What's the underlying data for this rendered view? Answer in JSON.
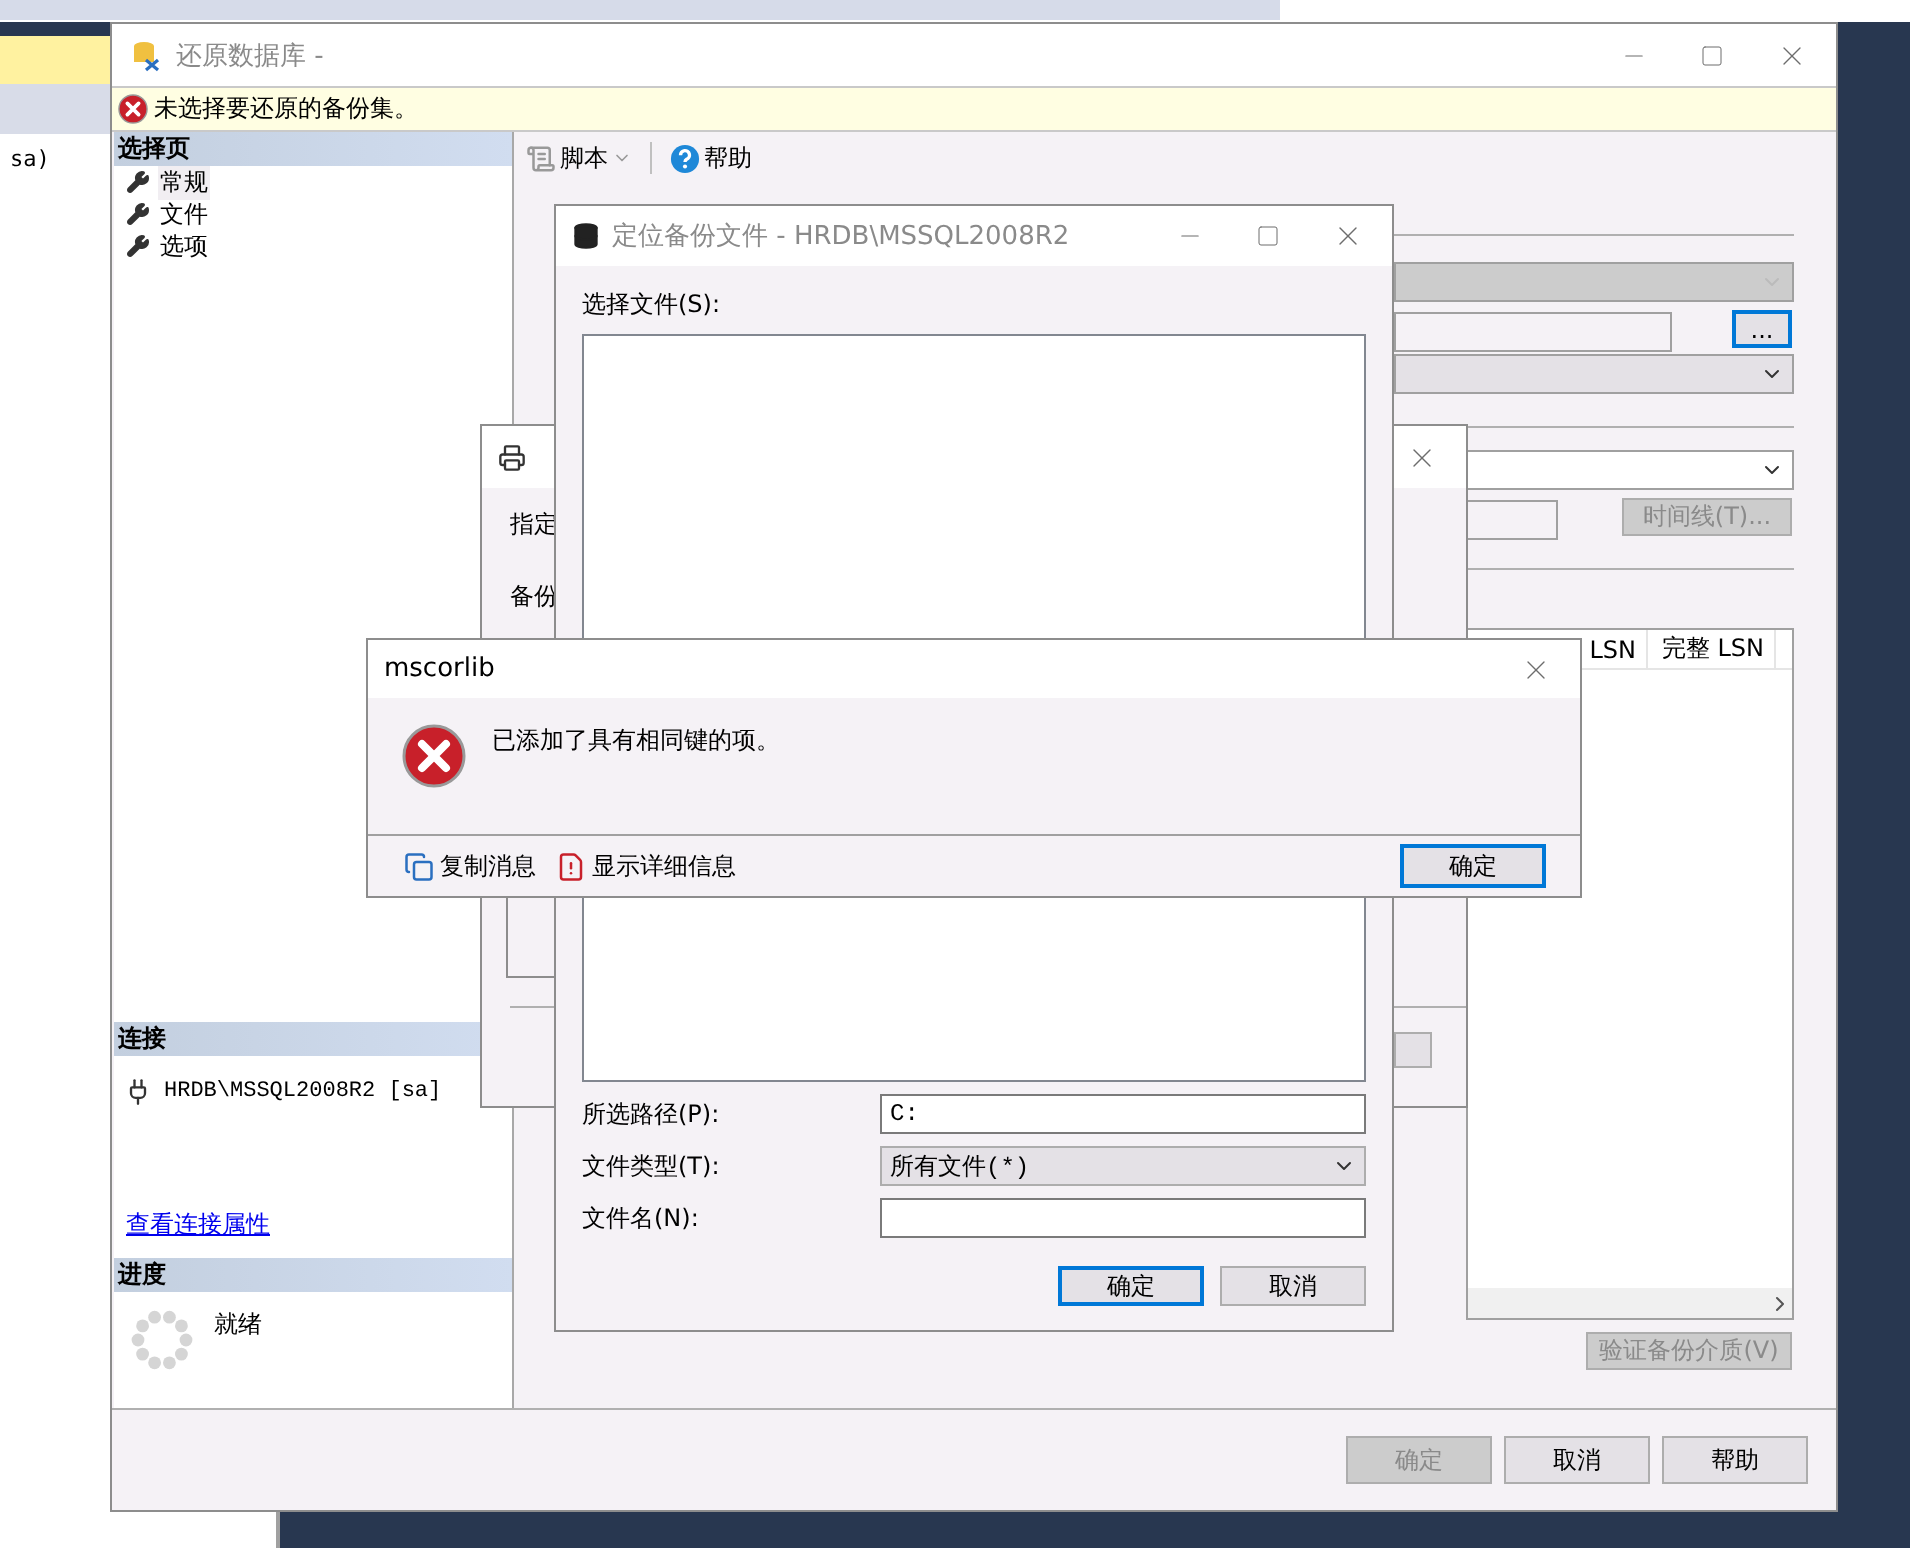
{
  "background_window": {
    "text": "sa)"
  },
  "restore_window": {
    "title": "还原数据库 -",
    "error_bar": "未选择要还原的备份集。",
    "select_page": {
      "header": "选择页",
      "items": [
        {
          "label": "常规",
          "selected": true
        },
        {
          "label": "文件",
          "selected": false
        },
        {
          "label": "选项",
          "selected": false
        }
      ]
    },
    "connection": {
      "header": "连接",
      "server": "HRDB\\MSSQL2008R2 [sa]",
      "link": "查看连接属性"
    },
    "progress": {
      "header": "进度",
      "status": "就绪"
    },
    "toolbar": {
      "script": "脚本",
      "help": "帮助"
    },
    "browse_button": {
      "label": "...",
      "focused": true
    },
    "timeline_button": {
      "label": "时间线(T)...",
      "disabled": true
    },
    "grid_columns": [
      "LSN",
      "完整 LSN"
    ],
    "verify_button": {
      "label": "验证备份介质(V)",
      "disabled": true
    },
    "buttons": [
      {
        "label": "确定",
        "disabled": true
      },
      {
        "label": "取消",
        "disabled": false
      },
      {
        "label": "帮助",
        "disabled": false
      }
    ]
  },
  "device_window": {
    "texts": [
      "指定",
      "备份"
    ]
  },
  "locate_window": {
    "title": "定位备份文件 - HRDB\\MSSQL2008R2",
    "file_label": "选择文件(S):",
    "fields": [
      {
        "kind": "text",
        "label": "所选路径(P):",
        "value": "C:"
      },
      {
        "kind": "select",
        "label": "文件类型(T):",
        "value": "所有文件(*)"
      },
      {
        "kind": "text",
        "label": "文件名(N):"
      }
    ],
    "buttons": [
      {
        "label": "确定",
        "focused": true
      },
      {
        "label": "取消",
        "focused": false
      }
    ]
  },
  "message_box": {
    "title": "mscorlib",
    "message": "已添加了具有相同键的项。",
    "actions": [
      "复制消息",
      "显示详细信息"
    ],
    "button": {
      "label": "确定",
      "focused": true
    }
  }
}
